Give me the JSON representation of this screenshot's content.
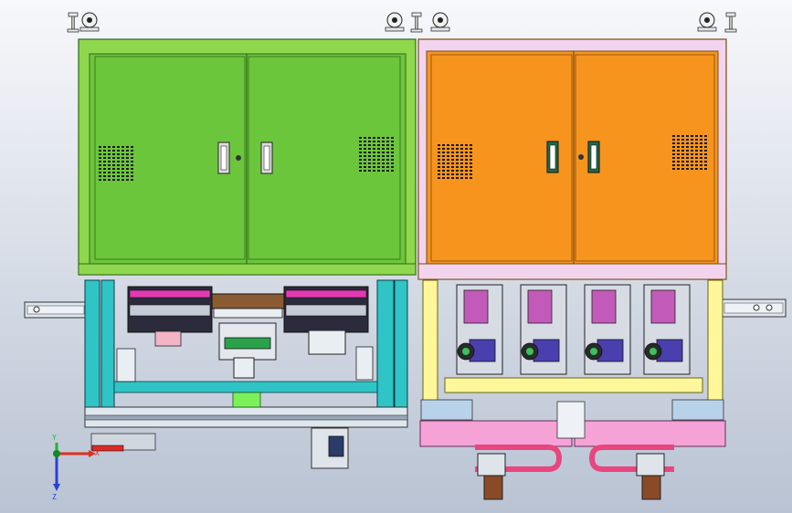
{
  "viewport": {
    "background_top": "#f7f8fb",
    "background_bottom": "#b9c3d3"
  },
  "model": {
    "left_cabinet": {
      "body_color": "#6cc63c",
      "frame_color": "#8fd84e",
      "edge_color": "#2f6a18",
      "vent_color": "#1a1a1a"
    },
    "right_cabinet": {
      "body_color": "#f7941e",
      "frame_color": "#f3d4ee",
      "edge_color": "#7a4a12",
      "vent_color": "#1a1a1a"
    },
    "left_frame_color": "#2fc4c6",
    "right_frame_color": "#fff79a",
    "pink_plate_color": "#f5a3d6",
    "caster_icon": "caster-wheel-icon",
    "leveling_foot_icon": "leveling-foot-icon"
  },
  "triad": {
    "x_label": "X",
    "y_label": "Y",
    "z_label": "Z",
    "x_color": "#e0301e",
    "y_color": "#1eb53a",
    "z_color": "#2b3fd6"
  }
}
